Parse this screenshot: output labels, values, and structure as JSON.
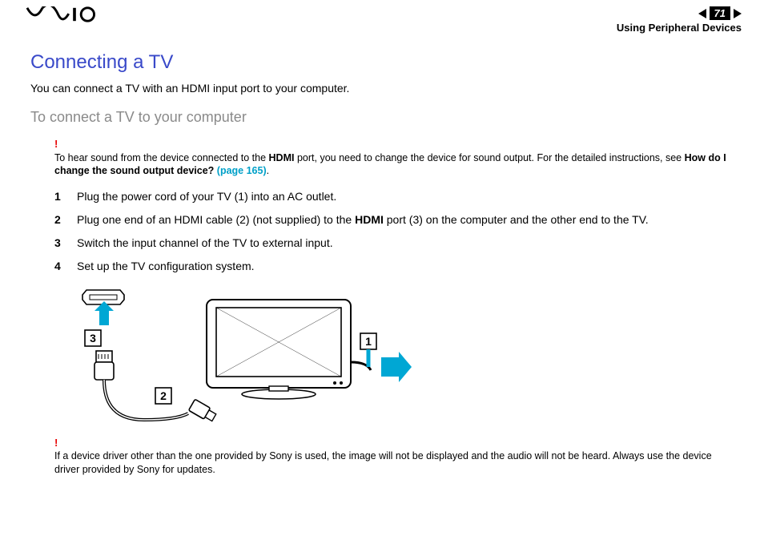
{
  "header": {
    "page_number": "71",
    "section": "Using Peripheral Devices"
  },
  "title": "Connecting a TV",
  "intro": "You can connect a TV with an HDMI input port to your computer.",
  "subtitle": "To connect a TV to your computer",
  "note1": {
    "prefix": "To hear sound from the device connected to the ",
    "bold1": "HDMI",
    "mid": " port, you need to change the device for sound output. For the detailed instructions, see ",
    "bold2": "How do I change the sound output device? ",
    "link": "(page 165)",
    "suffix": "."
  },
  "steps": [
    {
      "n": "1",
      "text_a": "Plug the power cord of your TV (1) into an AC outlet.",
      "bold": "",
      "text_b": ""
    },
    {
      "n": "2",
      "text_a": "Plug one end of an HDMI cable (2) (not supplied) to the ",
      "bold": "HDMI",
      "text_b": " port (3) on the computer and the other end to the TV."
    },
    {
      "n": "3",
      "text_a": "Switch the input channel of the TV to external input.",
      "bold": "",
      "text_b": ""
    },
    {
      "n": "4",
      "text_a": "Set up the TV configuration system.",
      "bold": "",
      "text_b": ""
    }
  ],
  "diagram_labels": {
    "l1": "1",
    "l2": "2",
    "l3": "3"
  },
  "note2": "If a device driver other than the one provided by Sony is used, the image will not be displayed and the audio will not be heard. Always use the device driver provided by Sony for updates."
}
